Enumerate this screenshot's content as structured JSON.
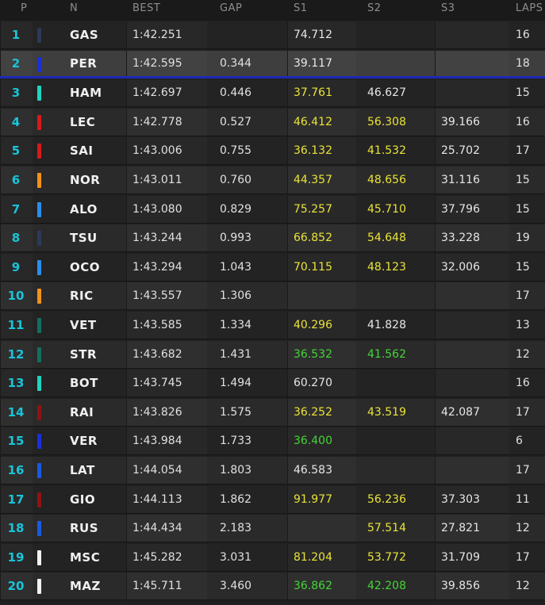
{
  "header": {
    "pos": "P",
    "name": "N",
    "best": "BEST",
    "gap": "GAP",
    "s1": "S1",
    "s2": "S2",
    "s3": "S3",
    "laps": "LAPS"
  },
  "colors": {
    "white": "#e6e6e6",
    "yellow": "#e9e338",
    "green": "#44d538",
    "position": "#19c4d8",
    "highlight_line": "#1c2ab8"
  },
  "rows": [
    {
      "pos": "1",
      "code": "GAS",
      "team_color": "#2b3a57",
      "best": "1:42.251",
      "gap": "",
      "s1": "74.712",
      "s1_c": "white",
      "s2": "",
      "s2_c": "white",
      "s3": "",
      "s3_c": "white",
      "laps": "16"
    },
    {
      "pos": "2",
      "code": "PER",
      "team_color": "#1a2fd6",
      "best": "1:42.595",
      "gap": "0.344",
      "s1": "39.117",
      "s1_c": "white",
      "s2": "",
      "s2_c": "white",
      "s3": "",
      "s3_c": "white",
      "laps": "18",
      "highlight": true
    },
    {
      "pos": "3",
      "code": "HAM",
      "team_color": "#1fd4c0",
      "best": "1:42.697",
      "gap": "0.446",
      "s1": "37.761",
      "s1_c": "yellow",
      "s2": "46.627",
      "s2_c": "white",
      "s3": "",
      "s3_c": "white",
      "laps": "15"
    },
    {
      "pos": "4",
      "code": "LEC",
      "team_color": "#d61a1a",
      "best": "1:42.778",
      "gap": "0.527",
      "s1": "46.412",
      "s1_c": "yellow",
      "s2": "56.308",
      "s2_c": "yellow",
      "s3": "39.166",
      "s3_c": "white",
      "laps": "16"
    },
    {
      "pos": "5",
      "code": "SAI",
      "team_color": "#d61a1a",
      "best": "1:43.006",
      "gap": "0.755",
      "s1": "36.132",
      "s1_c": "yellow",
      "s2": "41.532",
      "s2_c": "yellow",
      "s3": "25.702",
      "s3_c": "white",
      "laps": "17"
    },
    {
      "pos": "6",
      "code": "NOR",
      "team_color": "#f2921a",
      "best": "1:43.011",
      "gap": "0.760",
      "s1": "44.357",
      "s1_c": "yellow",
      "s2": "48.656",
      "s2_c": "yellow",
      "s3": "31.116",
      "s3_c": "white",
      "laps": "15"
    },
    {
      "pos": "7",
      "code": "ALO",
      "team_color": "#2a8ee8",
      "best": "1:43.080",
      "gap": "0.829",
      "s1": "75.257",
      "s1_c": "yellow",
      "s2": "45.710",
      "s2_c": "yellow",
      "s3": "37.796",
      "s3_c": "white",
      "laps": "15"
    },
    {
      "pos": "8",
      "code": "TSU",
      "team_color": "#2b3a57",
      "best": "1:43.244",
      "gap": "0.993",
      "s1": "66.852",
      "s1_c": "yellow",
      "s2": "54.648",
      "s2_c": "yellow",
      "s3": "33.228",
      "s3_c": "white",
      "laps": "19"
    },
    {
      "pos": "9",
      "code": "OCO",
      "team_color": "#2a8ee8",
      "best": "1:43.294",
      "gap": "1.043",
      "s1": "70.115",
      "s1_c": "yellow",
      "s2": "48.123",
      "s2_c": "yellow",
      "s3": "32.006",
      "s3_c": "white",
      "laps": "15"
    },
    {
      "pos": "10",
      "code": "RIC",
      "team_color": "#f2921a",
      "best": "1:43.557",
      "gap": "1.306",
      "s1": "",
      "s1_c": "white",
      "s2": "",
      "s2_c": "white",
      "s3": "",
      "s3_c": "white",
      "laps": "17"
    },
    {
      "pos": "11",
      "code": "VET",
      "team_color": "#146e5e",
      "best": "1:43.585",
      "gap": "1.334",
      "s1": "40.296",
      "s1_c": "yellow",
      "s2": "41.828",
      "s2_c": "white",
      "s3": "",
      "s3_c": "white",
      "laps": "13"
    },
    {
      "pos": "12",
      "code": "STR",
      "team_color": "#146e5e",
      "best": "1:43.682",
      "gap": "1.431",
      "s1": "36.532",
      "s1_c": "green",
      "s2": "41.562",
      "s2_c": "green",
      "s3": "",
      "s3_c": "white",
      "laps": "12"
    },
    {
      "pos": "13",
      "code": "BOT",
      "team_color": "#1fd4c0",
      "best": "1:43.745",
      "gap": "1.494",
      "s1": "60.270",
      "s1_c": "white",
      "s2": "",
      "s2_c": "white",
      "s3": "",
      "s3_c": "white",
      "laps": "16"
    },
    {
      "pos": "14",
      "code": "RAI",
      "team_color": "#8e1414",
      "best": "1:43.826",
      "gap": "1.575",
      "s1": "36.252",
      "s1_c": "yellow",
      "s2": "43.519",
      "s2_c": "yellow",
      "s3": "42.087",
      "s3_c": "white",
      "laps": "17"
    },
    {
      "pos": "15",
      "code": "VER",
      "team_color": "#1a2fd6",
      "best": "1:43.984",
      "gap": "1.733",
      "s1": "36.400",
      "s1_c": "green",
      "s2": "",
      "s2_c": "white",
      "s3": "",
      "s3_c": "white",
      "laps": "6"
    },
    {
      "pos": "16",
      "code": "LAT",
      "team_color": "#1a5ae0",
      "best": "1:44.054",
      "gap": "1.803",
      "s1": "46.583",
      "s1_c": "white",
      "s2": "",
      "s2_c": "white",
      "s3": "",
      "s3_c": "white",
      "laps": "17"
    },
    {
      "pos": "17",
      "code": "GIO",
      "team_color": "#8e1414",
      "best": "1:44.113",
      "gap": "1.862",
      "s1": "91.977",
      "s1_c": "yellow",
      "s2": "56.236",
      "s2_c": "yellow",
      "s3": "37.303",
      "s3_c": "white",
      "laps": "11"
    },
    {
      "pos": "18",
      "code": "RUS",
      "team_color": "#1a5ae0",
      "best": "1:44.434",
      "gap": "2.183",
      "s1": "",
      "s1_c": "white",
      "s2": "57.514",
      "s2_c": "yellow",
      "s3": "27.821",
      "s3_c": "white",
      "laps": "12"
    },
    {
      "pos": "19",
      "code": "MSC",
      "team_color": "#f2f2f2",
      "best": "1:45.282",
      "gap": "3.031",
      "s1": "81.204",
      "s1_c": "yellow",
      "s2": "53.772",
      "s2_c": "yellow",
      "s3": "31.709",
      "s3_c": "white",
      "laps": "17"
    },
    {
      "pos": "20",
      "code": "MAZ",
      "team_color": "#f2f2f2",
      "best": "1:45.711",
      "gap": "3.460",
      "s1": "36.862",
      "s1_c": "green",
      "s2": "42.208",
      "s2_c": "green",
      "s3": "39.856",
      "s3_c": "white",
      "laps": "12"
    }
  ]
}
